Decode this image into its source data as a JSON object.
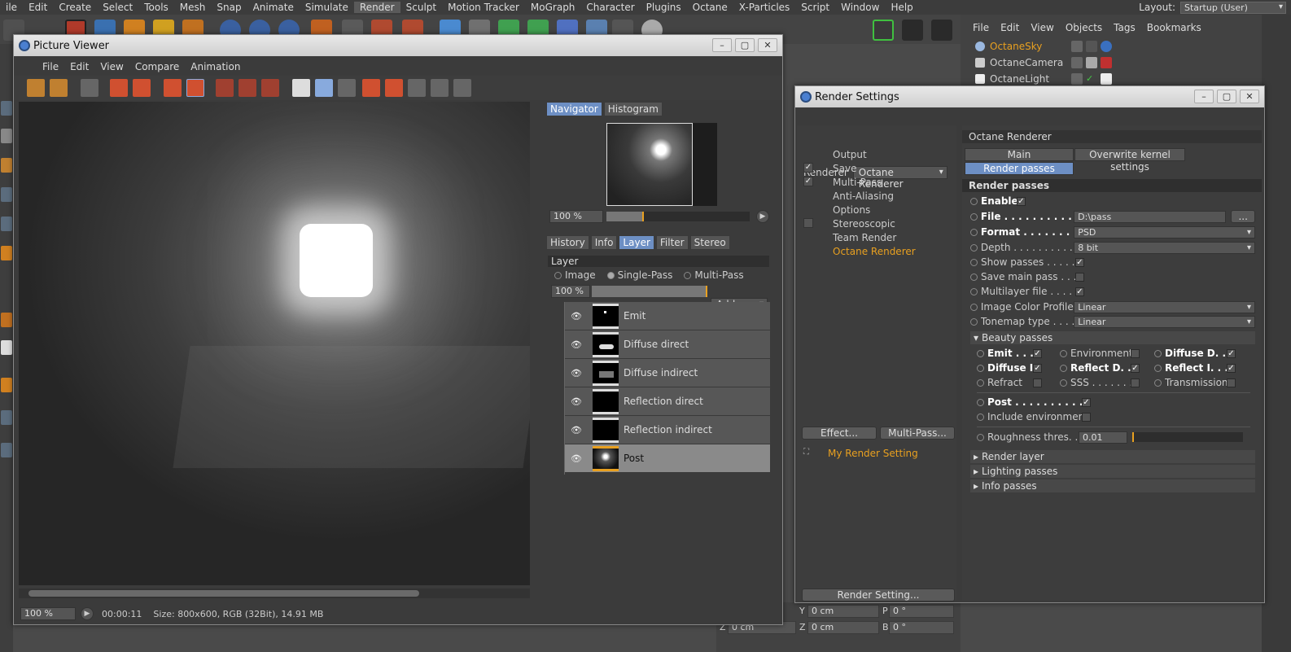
{
  "menubar": {
    "items": [
      "ile",
      "Edit",
      "Create",
      "Select",
      "Tools",
      "Mesh",
      "Snap",
      "Animate",
      "Simulate",
      "Render",
      "Sculpt",
      "Motion Tracker",
      "MoGraph",
      "Character",
      "Plugins",
      "Octane",
      "X-Particles",
      "Script",
      "Window",
      "Help"
    ],
    "active": "Render",
    "layout_label": "Layout:",
    "layout_value": "Startup (User)"
  },
  "object_manager": {
    "menu": [
      "File",
      "Edit",
      "View",
      "Objects",
      "Tags",
      "Bookmarks"
    ],
    "objects": [
      {
        "name": "OctaneSky",
        "highlight": true
      },
      {
        "name": "OctaneCamera",
        "highlight": false
      },
      {
        "name": "OctaneLight",
        "highlight": false
      }
    ]
  },
  "coords": {
    "y_pos": "0 cm",
    "p_rot": "0 °",
    "z_size": "0 cm",
    "z_pos": "0 cm",
    "b_rot": "0 °",
    "y_label": "Y",
    "p_label": "P",
    "z_label": "Z",
    "b_label": "B"
  },
  "picture_viewer": {
    "title": "Picture Viewer",
    "menu": [
      "File",
      "Edit",
      "View",
      "Compare",
      "Animation"
    ],
    "navigator_tabs": [
      "Navigator",
      "Histogram"
    ],
    "navigator_zoom": "100 %",
    "layer_tabs": [
      "History",
      "Info",
      "Layer",
      "Filter",
      "Stereo"
    ],
    "layer_header": "Layer",
    "layer_modes": [
      {
        "label": "Image",
        "on": false
      },
      {
        "label": "Single-Pass",
        "on": true
      },
      {
        "label": "Multi-Pass",
        "on": false
      }
    ],
    "layer_zoom": "100 %",
    "add_label": "Add",
    "layers": [
      "Emit",
      "Diffuse direct",
      "Diffuse indirect",
      "Reflection direct",
      "Reflection indirect",
      "Post"
    ],
    "selected_layer": "Post",
    "status_zoom": "100 %",
    "status_time": "00:00:11",
    "status_info": "Size: 800x600, RGB (32Bit), 14.91 MB"
  },
  "render_settings": {
    "title": "Render Settings",
    "renderer_label": "Renderer",
    "renderer_value": "Octane Renderer",
    "nav": [
      {
        "label": "Output",
        "check": null
      },
      {
        "label": "Save",
        "check": true
      },
      {
        "label": "Multi-Pass",
        "check": true
      },
      {
        "label": "Anti-Aliasing",
        "check": null
      },
      {
        "label": "Options",
        "check": null
      },
      {
        "label": "Stereoscopic",
        "check": false
      },
      {
        "label": "Team Render",
        "check": null
      },
      {
        "label": "Octane Renderer",
        "check": null
      }
    ],
    "effect_btn": "Effect...",
    "multipass_btn": "Multi-Pass...",
    "my_setting": "My Render Setting",
    "render_setting_btn": "Render Setting...",
    "panel_title": "Octane Renderer",
    "tabs": [
      "Main",
      "Overwrite kernel settings",
      "Render passes"
    ],
    "section": "Render passes",
    "enable_label": "Enable",
    "file_label": "File . . . . . . . . . . . . .",
    "file_value": "D:\\pass",
    "file_btn": "...",
    "format_label": "Format . . . . . . . . . .",
    "format_value": "PSD",
    "depth_label": "Depth . . . . . . . . . . .",
    "depth_value": "8 bit",
    "show_passes": "Show passes . . . . .",
    "save_main": "Save main pass . . .",
    "multilayer": "Multilayer file . . . .",
    "color_profile_label": "Image Color Profile",
    "color_profile_value": "Linear",
    "tonemap_label": "Tonemap type . . . .",
    "tonemap_value": "Linear",
    "beauty_label": "Beauty passes",
    "beauty": [
      {
        "label": "Emit . . .",
        "checked": true,
        "bold": true
      },
      {
        "label": "Environment",
        "checked": false,
        "bold": false
      },
      {
        "label": "Diffuse D. . .",
        "checked": true,
        "bold": true
      },
      {
        "label": "Diffuse I.",
        "checked": true,
        "bold": true
      },
      {
        "label": "Reflect D. . .",
        "checked": true,
        "bold": true
      },
      {
        "label": "Reflect I. . .",
        "checked": true,
        "bold": true
      },
      {
        "label": "Refract",
        "checked": false,
        "bold": false
      },
      {
        "label": "SSS . . . . . . . .",
        "checked": false,
        "bold": false
      },
      {
        "label": "Transmission",
        "checked": false,
        "bold": false
      }
    ],
    "post_label": "Post . . . . . . . . . . . . . .",
    "include_env": "Include environment",
    "roughness_label": "Roughness thres. . .",
    "roughness_value": "0.01",
    "folds": [
      "Render layer",
      "Lighting passes",
      "Info passes"
    ]
  },
  "colors": {
    "accent_orange": "#e8a020",
    "tab_blue": "#6d8fc4"
  }
}
